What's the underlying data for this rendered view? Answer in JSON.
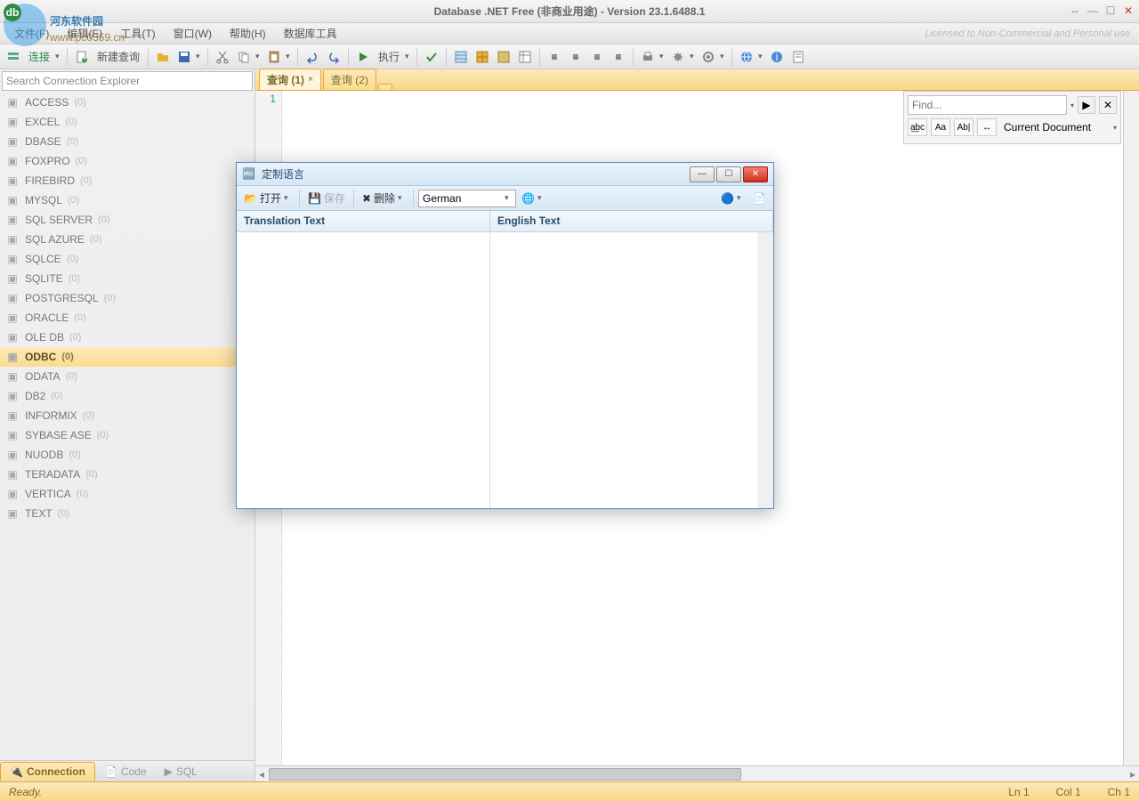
{
  "window": {
    "title": "Database .NET Free (非商业用途)  -  Version 23.1.6488.1"
  },
  "menu": {
    "items": [
      "文件(F)",
      "编辑(E)",
      "工具(T)",
      "窗口(W)",
      "帮助(H)",
      "数据库工具"
    ],
    "license": "Licensed to Non-Commercial and Personal use"
  },
  "toolbar": {
    "connect": "连接",
    "new_query": "新建查询",
    "execute": "执行"
  },
  "sidebar": {
    "search_placeholder": "Search Connection Explorer",
    "items": [
      {
        "name": "ACCESS",
        "count": "(0)"
      },
      {
        "name": "EXCEL",
        "count": "(0)"
      },
      {
        "name": "DBASE",
        "count": "(0)"
      },
      {
        "name": "FOXPRO",
        "count": "(0)"
      },
      {
        "name": "FIREBIRD",
        "count": "(0)"
      },
      {
        "name": "MYSQL",
        "count": "(0)"
      },
      {
        "name": "SQL SERVER",
        "count": "(0)"
      },
      {
        "name": "SQL AZURE",
        "count": "(0)"
      },
      {
        "name": "SQLCE",
        "count": "(0)"
      },
      {
        "name": "SQLITE",
        "count": "(0)"
      },
      {
        "name": "POSTGRESQL",
        "count": "(0)"
      },
      {
        "name": "ORACLE",
        "count": "(0)"
      },
      {
        "name": "OLE DB",
        "count": "(0)"
      },
      {
        "name": "ODBC",
        "count": "(0)",
        "selected": true
      },
      {
        "name": "ODATA",
        "count": "(0)"
      },
      {
        "name": "DB2",
        "count": "(0)"
      },
      {
        "name": "INFORMIX",
        "count": "(0)"
      },
      {
        "name": "SYBASE ASE",
        "count": "(0)"
      },
      {
        "name": "NUODB",
        "count": "(0)"
      },
      {
        "name": "TERADATA",
        "count": "(0)"
      },
      {
        "name": "VERTICA",
        "count": "(0)"
      },
      {
        "name": "TEXT",
        "count": "(0)"
      }
    ],
    "tabs": {
      "connection": "Connection",
      "code": "Code",
      "sql": "SQL"
    }
  },
  "editor": {
    "tabs": [
      {
        "label": "查询 (1)",
        "active": true,
        "close": "×"
      },
      {
        "label": "查询 (2)",
        "active": false
      }
    ],
    "line1": "1"
  },
  "find": {
    "placeholder": "Find...",
    "opts": {
      "regex": "a͟bc",
      "case": "Aa",
      "word": "Ab|",
      "arrow": "↔"
    },
    "scope": "Current Document"
  },
  "status": {
    "ready": "Ready.",
    "ln": "Ln 1",
    "col": "Col 1",
    "ch": "Ch 1"
  },
  "dialog": {
    "title": "定制语言",
    "open": "打开",
    "save": "保存",
    "delete": "删除",
    "language": "German",
    "col1": "Translation Text",
    "col2": "English Text",
    "min": "—",
    "max": "☐",
    "close": "✕"
  },
  "watermark": {
    "line1": "河东软件园",
    "line2": "www.pc0359.cn"
  }
}
